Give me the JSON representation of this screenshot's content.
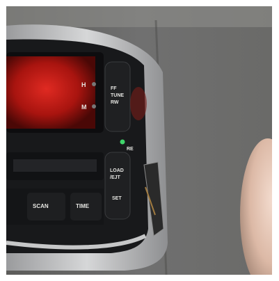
{
  "photo": {
    "subject": "car radio faceplate being removed from dashboard",
    "colors": {
      "panel": "#6e6e6b",
      "bezel": "#c9cacb",
      "radio_body": "#18191b",
      "display_glow": "#c21a16",
      "indicator_green": "#3fd46a"
    }
  },
  "radio": {
    "display": {
      "digits": "",
      "small_text": ""
    },
    "right_buttons": {
      "top_line1": "FF",
      "top_line2": "TUNE",
      "top_line3": "RW"
    },
    "left_markers": {
      "upper": "H",
      "lower": "M"
    },
    "indicator": {
      "label": "RE"
    },
    "lower_buttons": {
      "load_line1": "LOAD",
      "load_line2": "/EJT",
      "set": "SET"
    },
    "bottom_buttons": {
      "scan": "SCAN",
      "time": "TIME"
    }
  }
}
